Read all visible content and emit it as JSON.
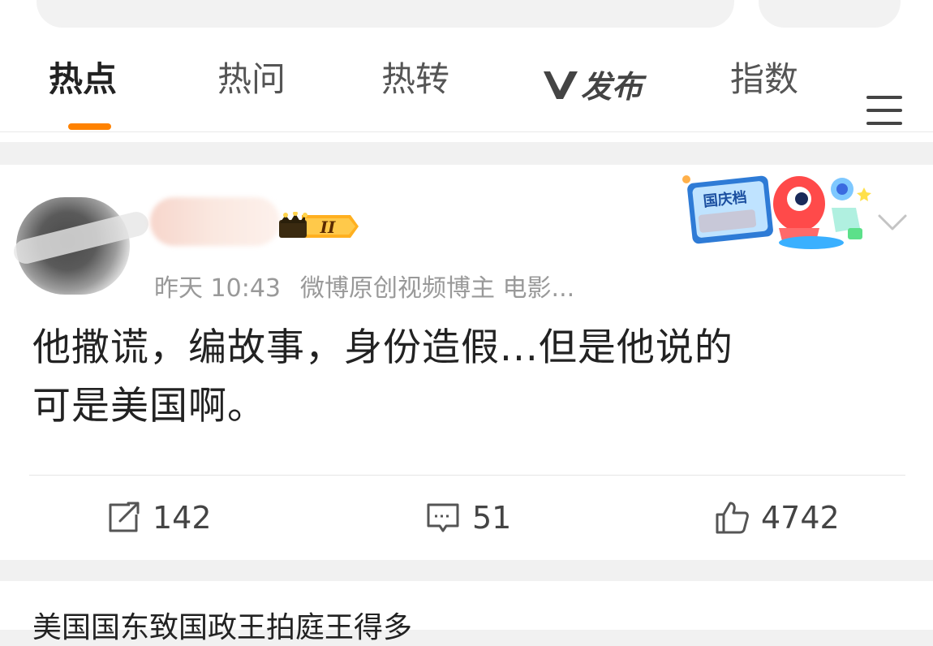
{
  "tabs": [
    {
      "label": "热点",
      "active": true
    },
    {
      "label": "热问",
      "active": false
    },
    {
      "label": "热转",
      "active": false
    },
    {
      "label": "发布",
      "brand": "V",
      "active": false
    },
    {
      "label": "指数",
      "active": false
    }
  ],
  "accent_color": "#ff8200",
  "post": {
    "time": "昨天 10:43",
    "source": "微博原创视频博主 电影...",
    "badge_level": "II",
    "sticker_label": "国庆档",
    "text_line1": "他撒谎，编故事，身份造假...但是他说的",
    "text_line2": "可是美国啊。",
    "reposts": "142",
    "comments": "51",
    "likes": "4742"
  },
  "next_post": {
    "text": "美国国东致国政王拍庭王得多"
  }
}
